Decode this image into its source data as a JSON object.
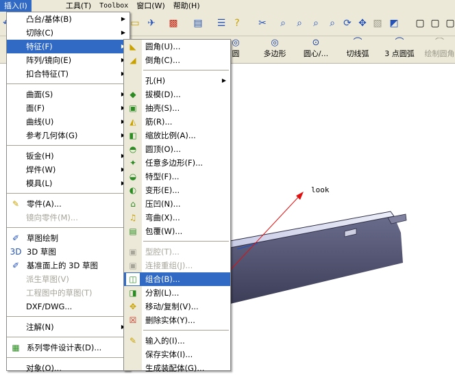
{
  "menubar": {
    "items": [
      {
        "label": "插入(I)",
        "active": true
      },
      {
        "label": "工具(T)"
      },
      {
        "label": "Toolbox",
        "mono": true
      },
      {
        "label": "窗口(W)"
      },
      {
        "label": "帮助(H)"
      }
    ]
  },
  "toolbar2": {
    "items": [
      {
        "label": "多边形",
        "icon": "◎"
      },
      {
        "label": "圆心/...",
        "icon": "⊙"
      },
      {
        "label": "切线弧",
        "icon": "⌒"
      },
      {
        "label": "3 点圆弧",
        "icon": "⌒"
      },
      {
        "label": "绘制圆角",
        "icon": "⌒",
        "disabled": true
      }
    ],
    "partial_label": "圆"
  },
  "insert_menu": {
    "items": [
      {
        "type": "item",
        "label": "凸台/基体(B)",
        "submenu": true
      },
      {
        "type": "item",
        "label": "切除(C)",
        "submenu": true
      },
      {
        "type": "item",
        "label": "特征(F)",
        "submenu": true,
        "highlight": true
      },
      {
        "type": "item",
        "label": "阵列/镜向(E)",
        "submenu": true
      },
      {
        "type": "item",
        "label": "扣合特征(T)",
        "submenu": true
      },
      {
        "type": "sep"
      },
      {
        "type": "item",
        "label": "曲面(S)",
        "submenu": true
      },
      {
        "type": "item",
        "label": "面(F)",
        "submenu": true
      },
      {
        "type": "item",
        "label": "曲线(U)",
        "submenu": true
      },
      {
        "type": "item",
        "label": "参考几何体(G)",
        "submenu": true
      },
      {
        "type": "sep"
      },
      {
        "type": "item",
        "label": "钣金(H)",
        "submenu": true
      },
      {
        "type": "item",
        "label": "焊件(W)",
        "submenu": true
      },
      {
        "type": "item",
        "label": "模具(L)",
        "submenu": true
      },
      {
        "type": "sep"
      },
      {
        "type": "item",
        "label": "零件(A)...",
        "icon": "part-icon",
        "glyph": "✎",
        "color": "ico-yellow"
      },
      {
        "type": "item",
        "label": "镜向零件(M)...",
        "disabled": true
      },
      {
        "type": "sep"
      },
      {
        "type": "item",
        "label": "草图绘制",
        "icon": "sketch-icon",
        "glyph": "✐",
        "color": "ico-blue"
      },
      {
        "type": "item",
        "label": "3D 草图",
        "icon": "3d-sketch-icon",
        "glyph": "3D",
        "color": "ico-blue"
      },
      {
        "type": "item",
        "label": "基准面上的 3D 草图",
        "icon": "3d-sketch-on-plane-icon",
        "glyph": "✐",
        "color": "ico-blue"
      },
      {
        "type": "item",
        "label": "派生草图(V)",
        "disabled": true
      },
      {
        "type": "item",
        "label": "工程图中的草图(T)",
        "disabled": true
      },
      {
        "type": "item",
        "label": "DXF/DWG..."
      },
      {
        "type": "sep"
      },
      {
        "type": "item",
        "label": "注解(N)",
        "submenu": true
      },
      {
        "type": "sep"
      },
      {
        "type": "item",
        "label": "系列零件设计表(D)...",
        "icon": "design-table-icon",
        "glyph": "▦",
        "color": "ico-green"
      },
      {
        "type": "sep"
      },
      {
        "type": "item",
        "label": "对象(O)..."
      }
    ]
  },
  "features_submenu": {
    "items": [
      {
        "type": "item",
        "label": "圆角(U)...",
        "icon": "fillet-icon",
        "glyph": "◣",
        "color": "ico-yellow"
      },
      {
        "type": "item",
        "label": "倒角(C)...",
        "icon": "chamfer-icon",
        "glyph": "◢",
        "color": "ico-yellow"
      },
      {
        "type": "sep"
      },
      {
        "type": "item",
        "label": "孔(H)",
        "submenu": true
      },
      {
        "type": "item",
        "label": "拔模(D)...",
        "icon": "draft-icon",
        "glyph": "◆",
        "color": "ico-green"
      },
      {
        "type": "item",
        "label": "抽壳(S)...",
        "icon": "shell-icon",
        "glyph": "▣",
        "color": "ico-green"
      },
      {
        "type": "item",
        "label": "筋(R)...",
        "icon": "rib-icon",
        "glyph": "◭",
        "color": "ico-yellow"
      },
      {
        "type": "item",
        "label": "缩放比例(A)...",
        "icon": "scale-icon",
        "glyph": "◧",
        "color": "ico-green"
      },
      {
        "type": "item",
        "label": "圆顶(O)...",
        "icon": "dome-icon",
        "glyph": "◓",
        "color": "ico-green"
      },
      {
        "type": "item",
        "label": "任意多边形(F)...",
        "icon": "freeform-icon",
        "glyph": "✦",
        "color": "ico-green"
      },
      {
        "type": "item",
        "label": "特型(F)...",
        "icon": "shape-icon",
        "glyph": "◒",
        "color": "ico-green"
      },
      {
        "type": "item",
        "label": "变形(E)...",
        "icon": "deform-icon",
        "glyph": "◐",
        "color": "ico-green"
      },
      {
        "type": "item",
        "label": "压凹(N)...",
        "icon": "indent-icon",
        "glyph": "⌂",
        "color": "ico-green"
      },
      {
        "type": "item",
        "label": "弯曲(X)...",
        "icon": "flex-icon",
        "glyph": "♫",
        "color": "ico-yellow"
      },
      {
        "type": "item",
        "label": "包覆(W)...",
        "icon": "wrap-icon",
        "glyph": "▤",
        "color": "ico-green"
      },
      {
        "type": "sep"
      },
      {
        "type": "item",
        "label": "型腔(T)...",
        "icon": "cavity-icon",
        "glyph": "▣",
        "color": "ico-gray",
        "disabled": true
      },
      {
        "type": "item",
        "label": "连接重组(J)...",
        "icon": "join-icon",
        "glyph": "▣",
        "color": "ico-gray",
        "disabled": true
      },
      {
        "type": "item",
        "label": "组合(B)...",
        "icon": "combine-icon",
        "glyph": "◫",
        "color": "ico-green",
        "highlight": true
      },
      {
        "type": "item",
        "label": "分割(L)...",
        "icon": "split-icon",
        "glyph": "◨",
        "color": "ico-green"
      },
      {
        "type": "item",
        "label": "移动/复制(V)...",
        "icon": "move-copy-icon",
        "glyph": "✥",
        "color": "ico-yellow"
      },
      {
        "type": "item",
        "label": "删除实体(Y)...",
        "icon": "delete-body-icon",
        "glyph": "☒",
        "color": "ico-red"
      },
      {
        "type": "sep"
      },
      {
        "type": "item",
        "label": "输入的(I)...",
        "icon": "imported-icon",
        "glyph": "✎",
        "color": "ico-yellow"
      },
      {
        "type": "item",
        "label": "保存实体(I)..."
      },
      {
        "type": "item",
        "label": "生成装配体(G)..."
      }
    ]
  },
  "graphics": {
    "annotation": "look"
  }
}
